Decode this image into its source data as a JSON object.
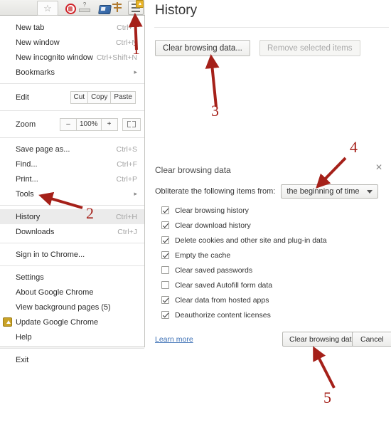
{
  "toolbar": {
    "star_icon": "star-icon",
    "shield_icon": "shield-icon",
    "help_icon": "help-icon",
    "screen_icon": "screen-icon",
    "wrench_icon": "wrench-icon",
    "menu_icon": "hamburger-menu-icon",
    "update_badge": "update-badge-icon"
  },
  "chrome_menu": {
    "items": [
      {
        "label": "New tab",
        "accel": "Ctrl+T"
      },
      {
        "label": "New window",
        "accel": "Ctrl+N"
      },
      {
        "label": "New incognito window",
        "accel": "Ctrl+Shift+N"
      },
      {
        "label": "Bookmarks",
        "accel": "",
        "submenu": "▸"
      }
    ],
    "edit_row": {
      "label": "Edit",
      "cut": "Cut",
      "copy": "Copy",
      "paste": "Paste"
    },
    "zoom_row": {
      "label": "Zoom",
      "minus": "–",
      "level": "100%",
      "plus": "+",
      "fullscreen_icon": "fullscreen-icon"
    },
    "items2": [
      {
        "label": "Save page as...",
        "accel": "Ctrl+S"
      },
      {
        "label": "Find...",
        "accel": "Ctrl+F"
      },
      {
        "label": "Print...",
        "accel": "Ctrl+P"
      },
      {
        "label": "Tools",
        "accel": "",
        "submenu": "▸"
      }
    ],
    "items3": [
      {
        "label": "History",
        "accel": "Ctrl+H"
      },
      {
        "label": "Downloads",
        "accel": "Ctrl+J"
      }
    ],
    "items4": [
      {
        "label": "Sign in to Chrome...",
        "accel": ""
      }
    ],
    "items5": [
      {
        "label": "Settings",
        "accel": ""
      },
      {
        "label": "About Google Chrome",
        "accel": ""
      },
      {
        "label": "View background pages (5)",
        "accel": ""
      },
      {
        "label": "Update Google Chrome",
        "accel": "",
        "icon": "update-icon"
      },
      {
        "label": "Help",
        "accel": ""
      }
    ],
    "items6": [
      {
        "label": "Exit",
        "accel": ""
      }
    ]
  },
  "history_page": {
    "title": "History",
    "clear_button": "Clear browsing data...",
    "remove_button": "Remove selected items"
  },
  "clear_browsing_data": {
    "title": "Clear browsing data",
    "close_icon": "close-icon",
    "obliterate_label": "Obliterate the following items from:",
    "time_range_selected": "the beginning of time",
    "options": [
      {
        "label": "Clear browsing history",
        "checked": true
      },
      {
        "label": "Clear download history",
        "checked": true
      },
      {
        "label": "Delete cookies and other site and plug-in data",
        "checked": true
      },
      {
        "label": "Empty the cache",
        "checked": true
      },
      {
        "label": "Clear saved passwords",
        "checked": false
      },
      {
        "label": "Clear saved Autofill form data",
        "checked": false
      },
      {
        "label": "Clear data from hosted apps",
        "checked": true
      },
      {
        "label": "Deauthorize content licenses",
        "checked": true
      }
    ],
    "learn_more": "Learn more",
    "confirm_button": "Clear browsing data",
    "cancel_button": "Cancel"
  },
  "annotations": {
    "color": "#a52019",
    "steps": [
      {
        "number": "1",
        "target": "menu-button"
      },
      {
        "number": "2",
        "target": "history-menu-item"
      },
      {
        "number": "3",
        "target": "clear-browsing-data-button"
      },
      {
        "number": "4",
        "target": "time-range-dropdown"
      },
      {
        "number": "5",
        "target": "clear-browsing-data-confirm-button"
      }
    ]
  }
}
